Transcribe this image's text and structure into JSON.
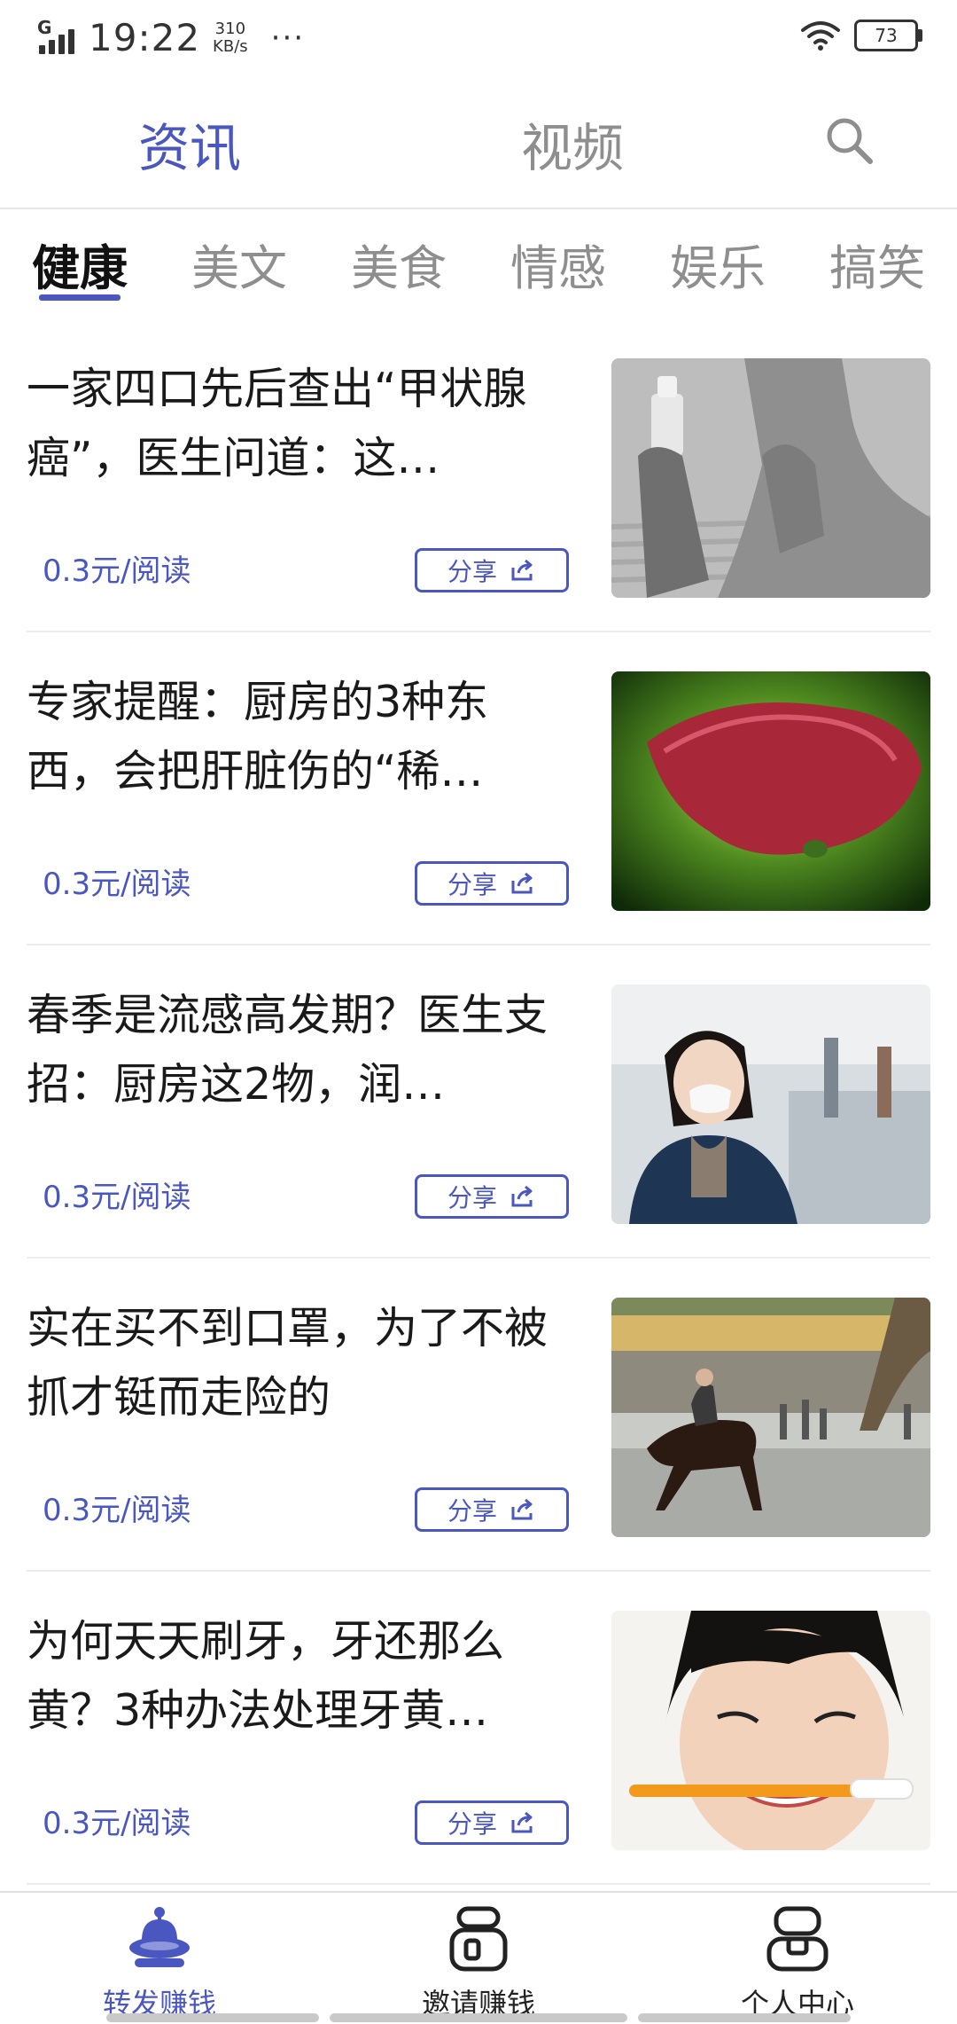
{
  "status_bar": {
    "network": "G",
    "time": "19:22",
    "speed_value": "310",
    "speed_unit": "KB/s",
    "more": "···",
    "battery": "73"
  },
  "top_tabs": {
    "active": "资讯",
    "inactive": "视频",
    "search_icon": "search-icon"
  },
  "categories": [
    "健康",
    "美文",
    "美食",
    "情感",
    "娱乐",
    "搞笑"
  ],
  "feed": [
    {
      "title": "一家四口先后查出“甲状腺癌”，医生问道：这…",
      "price": "0.3元/阅读",
      "share": "分享"
    },
    {
      "title": "专家提醒：厨房的3种东西，会把肝脏伤的“稀…",
      "price": "0.3元/阅读",
      "share": "分享"
    },
    {
      "title": "春季是流感高发期？医生支招：厨房这2物，润…",
      "price": "0.3元/阅读",
      "share": "分享"
    },
    {
      "title": "实在买不到口罩，为了不被抓才铤而走险的",
      "price": "0.3元/阅读",
      "share": "分享"
    },
    {
      "title": "为何天天刷牙，牙还那么黄？3种办法处理牙黄…",
      "price": "0.3元/阅读",
      "share": "分享"
    }
  ],
  "bottom_nav": [
    {
      "label": "转发赚钱",
      "icon": "ufo-icon",
      "active": true
    },
    {
      "label": "邀请赚钱",
      "icon": "invite-icon",
      "active": false
    },
    {
      "label": "个人中心",
      "icon": "profile-icon",
      "active": false
    }
  ],
  "colors": {
    "accent": "#4b57c0",
    "inactive": "#8e8e8e"
  }
}
